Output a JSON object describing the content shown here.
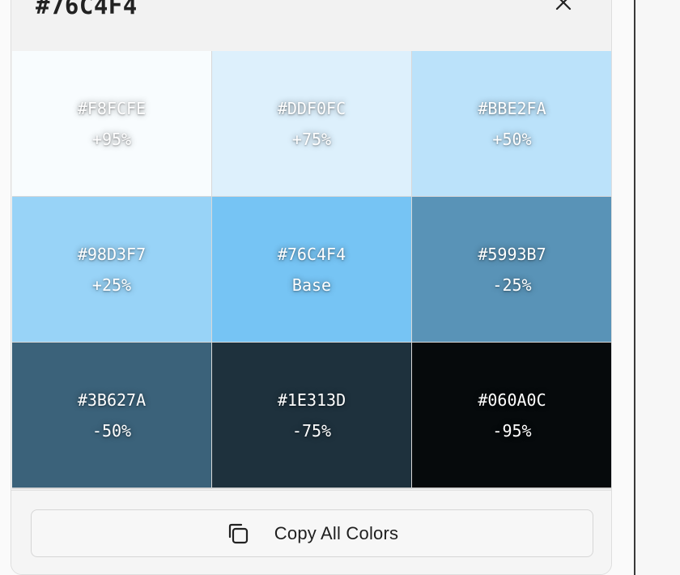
{
  "panel": {
    "title": "#76C4F4",
    "close_icon": "close-icon"
  },
  "swatches": [
    {
      "hex": "#F8FCFE",
      "label": "+95%",
      "color": "#F8FCFE"
    },
    {
      "hex": "#DDF0FC",
      "label": "+75%",
      "color": "#DDF0FC"
    },
    {
      "hex": "#BBE2FA",
      "label": "+50%",
      "color": "#BBE2FA"
    },
    {
      "hex": "#98D3F7",
      "label": "+25%",
      "color": "#98D3F7"
    },
    {
      "hex": "#76C4F4",
      "label": "Base",
      "color": "#76C4F4"
    },
    {
      "hex": "#5993B7",
      "label": "-25%",
      "color": "#5993B7"
    },
    {
      "hex": "#3B627A",
      "label": "-50%",
      "color": "#3B627A"
    },
    {
      "hex": "#1E313D",
      "label": "-75%",
      "color": "#1E313D"
    },
    {
      "hex": "#060A0C",
      "label": "-95%",
      "color": "#060A0C"
    }
  ],
  "footer": {
    "copy_all_label": "Copy All Colors",
    "copy_icon": "copy-icon"
  }
}
